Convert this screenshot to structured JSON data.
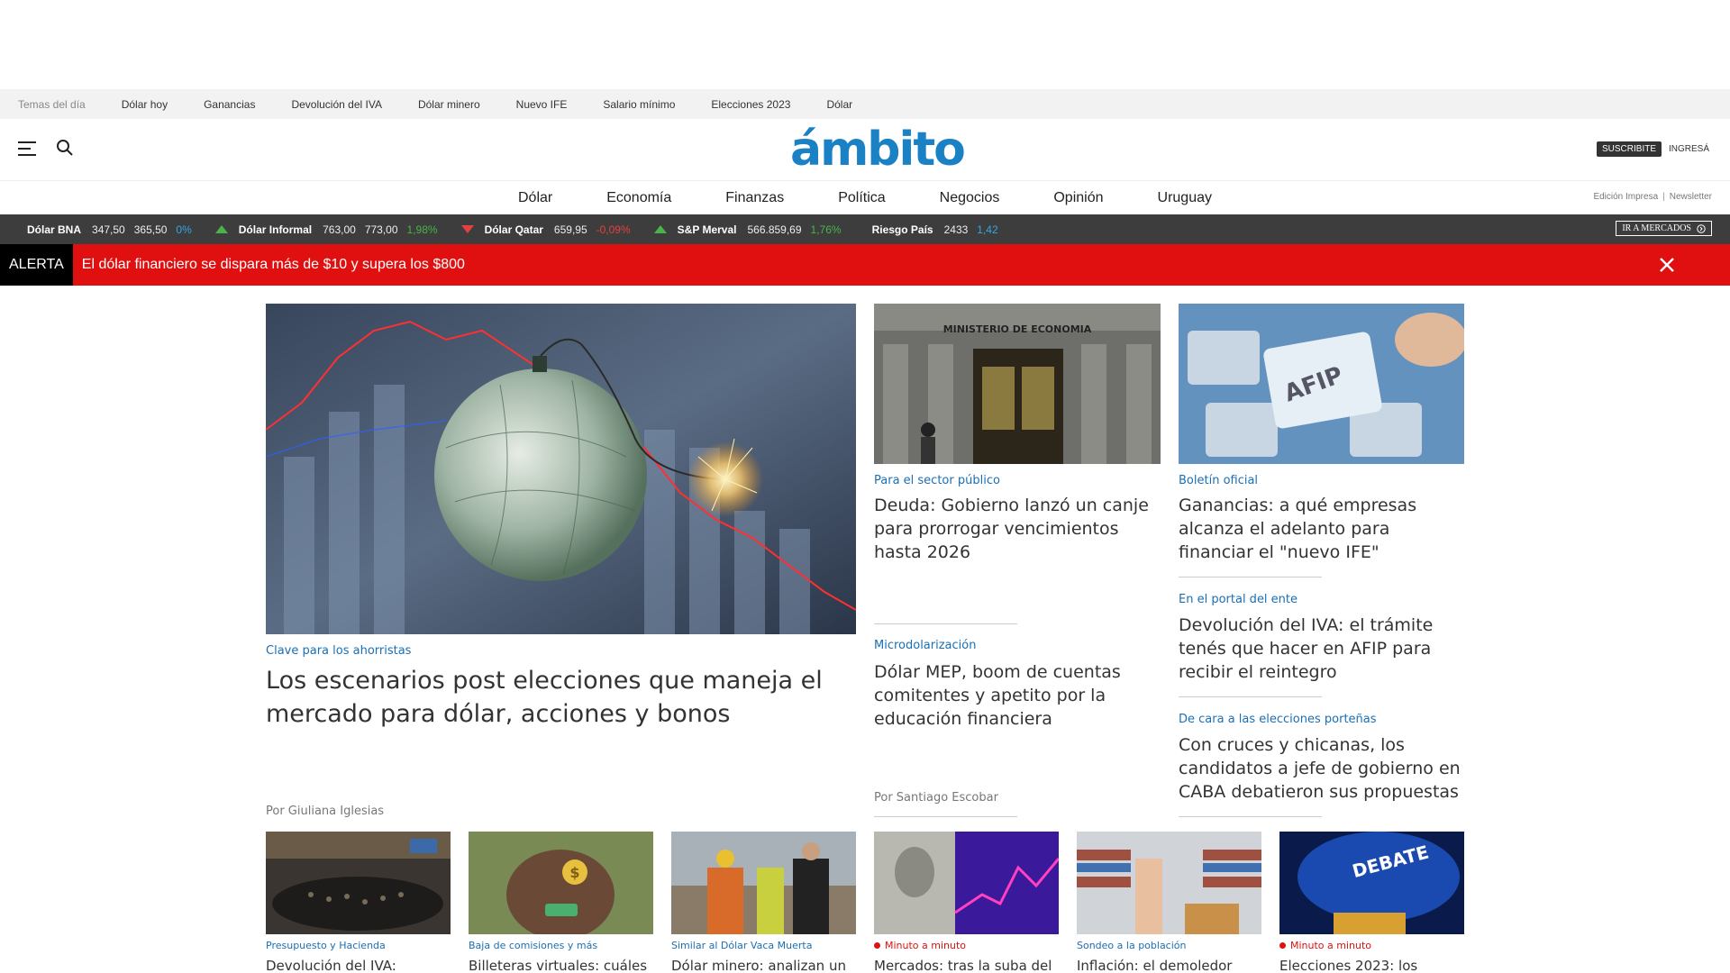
{
  "topics": {
    "heading": "Temas del día",
    "items": [
      "Dólar hoy",
      "Ganancias",
      "Devolución del IVA",
      "Dólar minero",
      "Nuevo IFE",
      "Salario mínimo",
      "Elecciones 2023",
      "Dólar"
    ]
  },
  "header": {
    "logo": "ámbito",
    "subscribe": "SUSCRIBITE",
    "login": "INGRESÁ"
  },
  "sections": {
    "items": [
      "Dólar",
      "Economía",
      "Finanzas",
      "Política",
      "Negocios",
      "Opinión",
      "Uruguay"
    ],
    "edicion": "Edición Impresa",
    "newsletter": "Newsletter"
  },
  "ticker": {
    "items": [
      {
        "name": "Dólar BNA",
        "v1": "347,50",
        "v2": "365,50",
        "pct": "0%",
        "trend": "flat"
      },
      {
        "name": "Dólar Informal",
        "v1": "763,00",
        "v2": "773,00",
        "pct": "1,98%",
        "trend": "up"
      },
      {
        "name": "Dólar Qatar",
        "v1": "659,95",
        "v2": "",
        "pct": "-0,09%",
        "trend": "down"
      },
      {
        "name": "S&P Merval",
        "v1": "566.859,69",
        "v2": "",
        "pct": "1,76%",
        "trend": "up"
      },
      {
        "name": "Riesgo País",
        "v1": "2433",
        "v2": "",
        "pct": "1,42",
        "trend": "flat"
      }
    ],
    "ir_mercados": "IR A MERCADOS"
  },
  "alert": {
    "tag": "ALERTA",
    "text": "El dólar financiero se dispara más de $10 y supera los $800"
  },
  "main_story": {
    "kicker": "Clave para los ahorristas",
    "headline": "Los escenarios post elecciones que maneja el mercado para dólar, acciones y bonos",
    "byline": "Por Giuliana Iglesias"
  },
  "col2": {
    "story1": {
      "kicker": "Para el sector público",
      "headline": "Deuda: Gobierno lanzó un canje para prorrogar vencimientos hasta 2026"
    },
    "story2": {
      "kicker": "Microdolarización",
      "headline": "Dólar MEP, boom de cuentas comitentes y apetito por la educación financiera",
      "byline": "Por Santiago Escobar"
    }
  },
  "col3": {
    "story1": {
      "kicker": "Boletín oficial",
      "headline": "Ganancias: a qué empresas alcanza el adelanto para financiar el \"nuevo IFE\""
    },
    "story2": {
      "kicker": "En el portal del ente",
      "headline": "Devolución del IVA: el trámite tenés que hacer en AFIP para recibir el reintegro"
    },
    "story3": {
      "kicker": "De cara a las elecciones porteñas",
      "headline": "Con cruces y chicanas, los candidatos a jefe de gobierno en CABA debatieron sus propuestas"
    }
  },
  "bottom_row": [
    {
      "kicker": "Presupuesto y Hacienda",
      "headline": "Devolución del IVA:",
      "live": false
    },
    {
      "kicker": "Baja de comisiones y más",
      "headline": "Billeteras virtuales: cuáles",
      "live": false
    },
    {
      "kicker": "Similar al Dólar Vaca Muerta",
      "headline": "Dólar minero: analizan un",
      "live": false
    },
    {
      "kicker": "Minuto a minuto",
      "headline": "Mercados: tras la suba del",
      "live": true
    },
    {
      "kicker": "Sondeo a la población",
      "headline": "Inflación: el demoledor",
      "live": false
    },
    {
      "kicker": "Minuto a minuto",
      "headline": "Elecciones 2023: los",
      "live": true
    }
  ],
  "image_labels": {
    "ministerio": "MINISTERIO DE ECONOMIA",
    "afip": "AFIP",
    "debate": "DEBATE"
  },
  "colors": {
    "brand": "#1a82c4",
    "alert": "#e01010",
    "ticker_bg": "#3d3d3d",
    "kicker": "#1a6fb5"
  }
}
